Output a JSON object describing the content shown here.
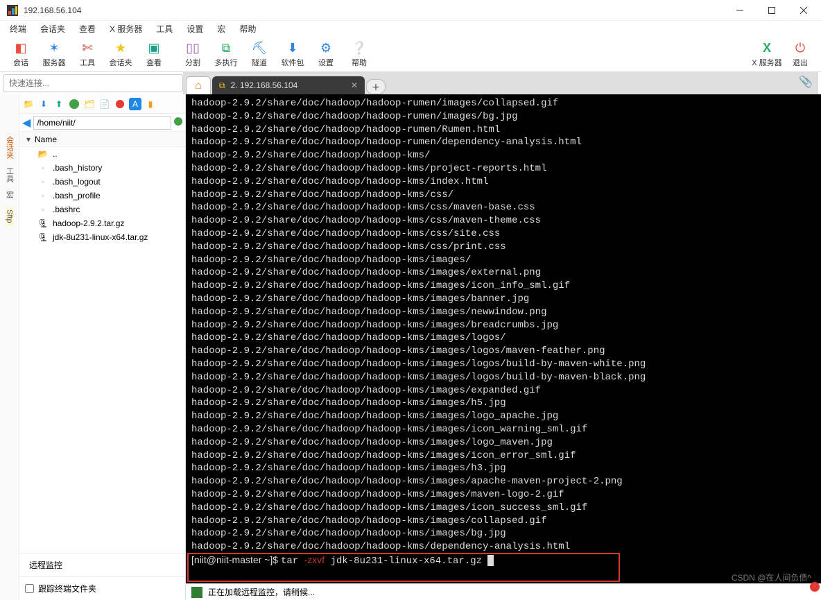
{
  "titlebar": {
    "title": "192.168.56.104"
  },
  "menu": {
    "items": [
      "终端",
      "会话夹",
      "查看",
      "X 服务器",
      "工具",
      "设置",
      "宏",
      "帮助"
    ]
  },
  "toolbar": {
    "items": [
      {
        "label": "会话",
        "icon": "session-icon",
        "color": "#e74c3c"
      },
      {
        "label": "服务器",
        "icon": "servers-icon",
        "color": "#2e86de"
      },
      {
        "label": "工具",
        "icon": "tools-icon",
        "color": "#c0392b"
      },
      {
        "label": "会话夹",
        "icon": "sessions-icon",
        "color": "#f1c40f"
      },
      {
        "label": "查看",
        "icon": "view-icon",
        "color": "#16a085"
      },
      {
        "label": "",
        "icon": "sep",
        "color": ""
      },
      {
        "label": "分割",
        "icon": "split-icon",
        "color": "#9b59b6"
      },
      {
        "label": "多执行",
        "icon": "multiexec-icon",
        "color": "#27ae60"
      },
      {
        "label": "隧道",
        "icon": "tunnel-icon",
        "color": "#2e86de"
      },
      {
        "label": "软件包",
        "icon": "packages-icon",
        "color": "#2e86de"
      },
      {
        "label": "设置",
        "icon": "settings-icon",
        "color": "#2e86de"
      },
      {
        "label": "帮助",
        "icon": "help-icon",
        "color": "#2e86de"
      }
    ],
    "right": [
      {
        "label": "X 服务器",
        "icon": "x-server-icon",
        "color": "#27ae60"
      },
      {
        "label": "退出",
        "icon": "exit-icon",
        "color": "#e74c3c"
      }
    ]
  },
  "quick_connect": {
    "placeholder": "快速连接..."
  },
  "left_rail": {
    "items": [
      "会话夹",
      "工具",
      "宏",
      "Sftp"
    ]
  },
  "file_panel": {
    "path": "/home/niit/",
    "header": "Name",
    "items": [
      {
        "name": "..",
        "icon": "up-dir-icon"
      },
      {
        "name": ".bash_history",
        "icon": "file-icon"
      },
      {
        "name": ".bash_logout",
        "icon": "file-icon"
      },
      {
        "name": ".bash_profile",
        "icon": "file-icon"
      },
      {
        "name": ".bashrc",
        "icon": "file-icon"
      },
      {
        "name": "hadoop-2.9.2.tar.gz",
        "icon": "archive-icon"
      },
      {
        "name": "jdk-8u231-linux-x64.tar.gz",
        "icon": "archive-icon"
      }
    ],
    "remote_label": "远程监控",
    "track_label": "跟踪终端文件夹"
  },
  "tabs": {
    "active_label": "2. 192.168.56.104"
  },
  "terminal": {
    "lines": [
      "hadoop-2.9.2/share/doc/hadoop/hadoop-rumen/images/collapsed.gif",
      "hadoop-2.9.2/share/doc/hadoop/hadoop-rumen/images/bg.jpg",
      "hadoop-2.9.2/share/doc/hadoop/hadoop-rumen/Rumen.html",
      "hadoop-2.9.2/share/doc/hadoop/hadoop-rumen/dependency-analysis.html",
      "hadoop-2.9.2/share/doc/hadoop/hadoop-kms/",
      "hadoop-2.9.2/share/doc/hadoop/hadoop-kms/project-reports.html",
      "hadoop-2.9.2/share/doc/hadoop/hadoop-kms/index.html",
      "hadoop-2.9.2/share/doc/hadoop/hadoop-kms/css/",
      "hadoop-2.9.2/share/doc/hadoop/hadoop-kms/css/maven-base.css",
      "hadoop-2.9.2/share/doc/hadoop/hadoop-kms/css/maven-theme.css",
      "hadoop-2.9.2/share/doc/hadoop/hadoop-kms/css/site.css",
      "hadoop-2.9.2/share/doc/hadoop/hadoop-kms/css/print.css",
      "hadoop-2.9.2/share/doc/hadoop/hadoop-kms/images/",
      "hadoop-2.9.2/share/doc/hadoop/hadoop-kms/images/external.png",
      "hadoop-2.9.2/share/doc/hadoop/hadoop-kms/images/icon_info_sml.gif",
      "hadoop-2.9.2/share/doc/hadoop/hadoop-kms/images/banner.jpg",
      "hadoop-2.9.2/share/doc/hadoop/hadoop-kms/images/newwindow.png",
      "hadoop-2.9.2/share/doc/hadoop/hadoop-kms/images/breadcrumbs.jpg",
      "hadoop-2.9.2/share/doc/hadoop/hadoop-kms/images/logos/",
      "hadoop-2.9.2/share/doc/hadoop/hadoop-kms/images/logos/maven-feather.png",
      "hadoop-2.9.2/share/doc/hadoop/hadoop-kms/images/logos/build-by-maven-white.png",
      "hadoop-2.9.2/share/doc/hadoop/hadoop-kms/images/logos/build-by-maven-black.png",
      "hadoop-2.9.2/share/doc/hadoop/hadoop-kms/images/expanded.gif",
      "hadoop-2.9.2/share/doc/hadoop/hadoop-kms/images/h5.jpg",
      "hadoop-2.9.2/share/doc/hadoop/hadoop-kms/images/logo_apache.jpg",
      "hadoop-2.9.2/share/doc/hadoop/hadoop-kms/images/icon_warning_sml.gif",
      "hadoop-2.9.2/share/doc/hadoop/hadoop-kms/images/logo_maven.jpg",
      "hadoop-2.9.2/share/doc/hadoop/hadoop-kms/images/icon_error_sml.gif",
      "hadoop-2.9.2/share/doc/hadoop/hadoop-kms/images/h3.jpg",
      "hadoop-2.9.2/share/doc/hadoop/hadoop-kms/images/apache-maven-project-2.png",
      "hadoop-2.9.2/share/doc/hadoop/hadoop-kms/images/maven-logo-2.gif",
      "hadoop-2.9.2/share/doc/hadoop/hadoop-kms/images/icon_success_sml.gif",
      "hadoop-2.9.2/share/doc/hadoop/hadoop-kms/images/collapsed.gif",
      "hadoop-2.9.2/share/doc/hadoop/hadoop-kms/images/bg.jpg",
      "hadoop-2.9.2/share/doc/hadoop/hadoop-kms/dependency-analysis.html"
    ],
    "prompt_user": "[niit@niit-master ~]$ ",
    "prompt_cmd": "tar ",
    "prompt_flag": "-zxvf",
    "prompt_arg": " jdk-8u231-linux-x64.tar.gz "
  },
  "statusbar": {
    "text": "正在加载远程监控，请稍候..."
  },
  "watermark": "CSDN @在人间负债^"
}
